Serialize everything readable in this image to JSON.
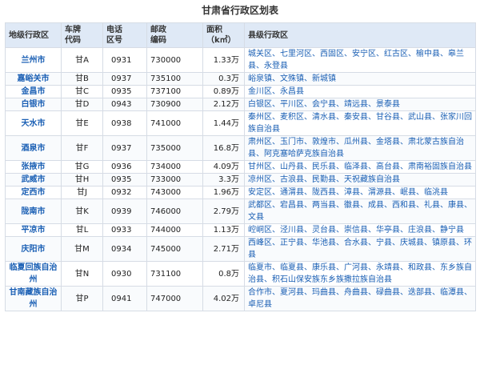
{
  "title": "甘肃省行政区划表",
  "headers": {
    "city": "地级行政区",
    "plate_l1": "车牌",
    "plate_l2": "代码",
    "phone_l1": "电话",
    "phone_l2": "区号",
    "post_l1": "邮政",
    "post_l2": "编码",
    "area_l1": "面积",
    "area_l2": "（k㎡）",
    "counties": "县级行政区"
  },
  "rows": [
    {
      "city": "兰州市",
      "plate": "甘A",
      "phone": "0931",
      "post": "730000",
      "area": "1.33万",
      "counties": [
        "城关区",
        "七里河区",
        "西固区",
        "安宁区",
        "红古区",
        "榆中县",
        "皋兰县",
        "永登县"
      ]
    },
    {
      "city": "嘉峪关市",
      "plate": "甘B",
      "phone": "0937",
      "post": "735100",
      "area": "0.3万",
      "counties": [
        "峪泉镇",
        "文殊镇",
        "新城镇"
      ]
    },
    {
      "city": "金昌市",
      "plate": "甘C",
      "phone": "0935",
      "post": "737100",
      "area": "0.89万",
      "counties": [
        "金川区",
        "永昌县"
      ]
    },
    {
      "city": "白银市",
      "plate": "甘D",
      "phone": "0943",
      "post": "730900",
      "area": "2.12万",
      "counties": [
        "白银区",
        "平川区",
        "会宁县",
        "靖远县",
        "景泰县"
      ]
    },
    {
      "city": "天水市",
      "plate": "甘E",
      "phone": "0938",
      "post": "741000",
      "area": "1.44万",
      "counties": [
        "秦州区",
        "麦积区",
        "清水县",
        "秦安县",
        "甘谷县",
        "武山县",
        "张家川回族自治县"
      ]
    },
    {
      "city": "酒泉市",
      "plate": "甘F",
      "phone": "0937",
      "post": "735000",
      "area": "16.8万",
      "counties": [
        "肃州区",
        "玉门市",
        "敦煌市",
        "瓜州县",
        "金塔县",
        "肃北蒙古族自治县",
        "阿克塞哈萨克族自治县"
      ]
    },
    {
      "city": "张掖市",
      "plate": "甘G",
      "phone": "0936",
      "post": "734000",
      "area": "4.09万",
      "counties": [
        "甘州区",
        "山丹县",
        "民乐县",
        "临泽县",
        "高台县",
        "肃南裕固族自治县"
      ]
    },
    {
      "city": "武威市",
      "plate": "甘H",
      "phone": "0935",
      "post": "733000",
      "area": "3.3万",
      "counties": [
        "凉州区",
        "古浪县",
        "民勤县",
        "天祝藏族自治县"
      ]
    },
    {
      "city": "定西市",
      "plate": "甘J",
      "phone": "0932",
      "post": "743000",
      "area": "1.96万",
      "counties": [
        "安定区",
        "通渭县",
        "陇西县",
        "漳县",
        "渭源县",
        "岷县",
        "临洮县"
      ]
    },
    {
      "city": "陇南市",
      "plate": "甘K",
      "phone": "0939",
      "post": "746000",
      "area": "2.79万",
      "counties": [
        "武都区",
        "宕昌县",
        "两当县",
        "徽县",
        "成县",
        "西和县",
        "礼县",
        "康县",
        "文县"
      ]
    },
    {
      "city": "平凉市",
      "plate": "甘L",
      "phone": "0933",
      "post": "744000",
      "area": "1.13万",
      "counties": [
        "崆峒区",
        "泾川县",
        "灵台县",
        "崇信县",
        "华亭县",
        "庄浪县",
        "静宁县"
      ]
    },
    {
      "city": "庆阳市",
      "plate": "甘M",
      "phone": "0934",
      "post": "745000",
      "area": "2.71万",
      "counties": [
        "西峰区",
        "正宁县",
        "华池县",
        "合水县",
        "宁县",
        "庆城县",
        "镇原县",
        "环县"
      ]
    },
    {
      "city": "临夏回族自治州",
      "plate": "甘N",
      "phone": "0930",
      "post": "731100",
      "area": "0.8万",
      "counties": [
        "临夏市",
        "临夏县",
        "康乐县",
        "广河县",
        "永靖县",
        "和政县",
        "东乡族自治县",
        "积石山保安族东乡族撒拉族自治县"
      ]
    },
    {
      "city": "甘南藏族自治州",
      "plate": "甘P",
      "phone": "0941",
      "post": "747000",
      "area": "4.02万",
      "counties": [
        "合作市",
        "夏河县",
        "玛曲县",
        "舟曲县",
        "碌曲县",
        "迭部县",
        "临潭县",
        "卓尼县"
      ]
    }
  ]
}
